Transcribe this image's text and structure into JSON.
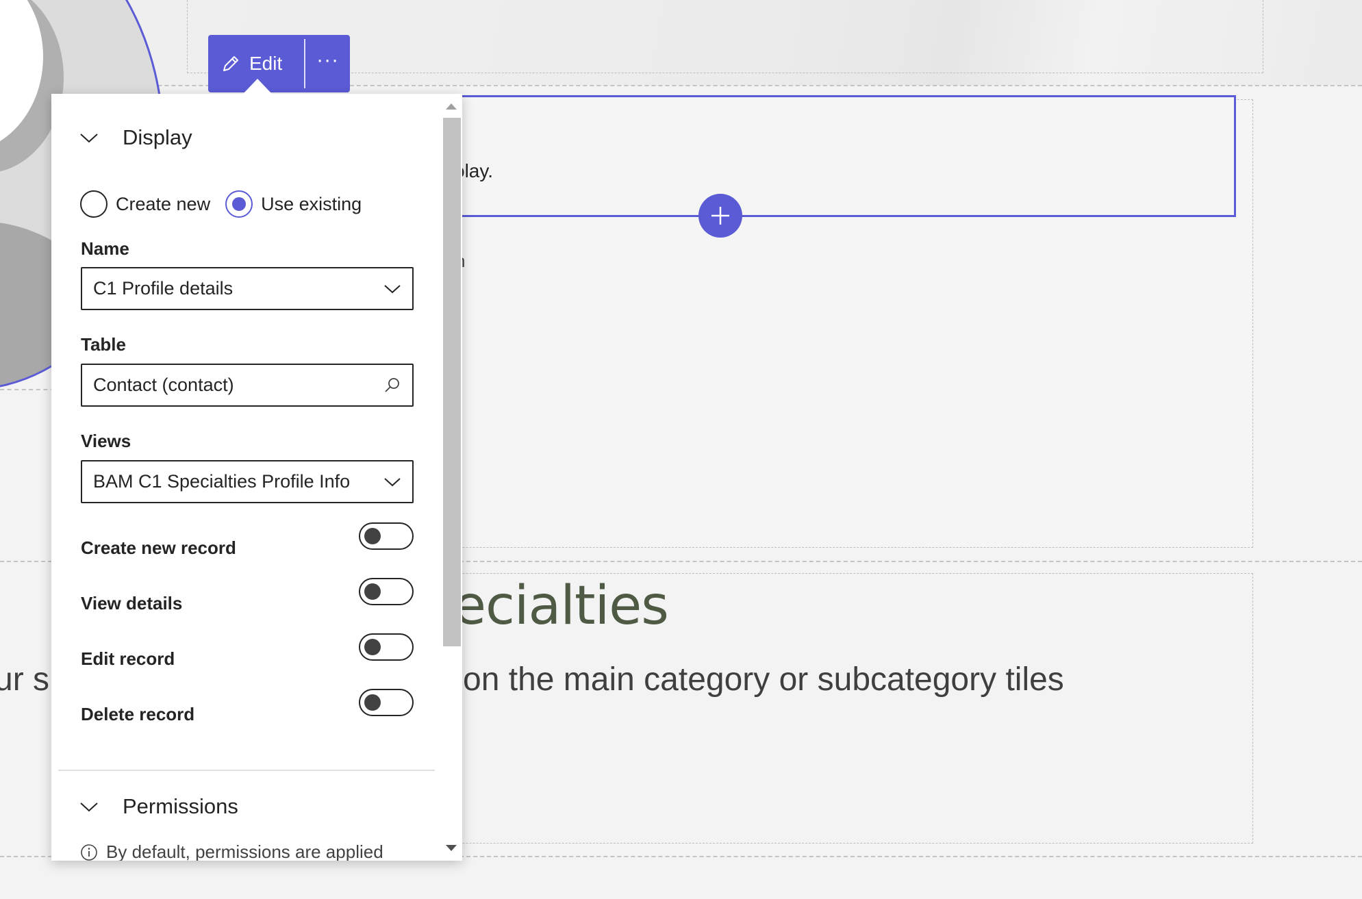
{
  "toolbar": {
    "edit_label": "Edit",
    "more_label": "···"
  },
  "canvas": {
    "list_text": "olay.",
    "stray_char": "n",
    "specialties_title": "ecialties",
    "specialties_subtitle": "on the main category or subcategory tiles",
    "specialties_left": "ur sp"
  },
  "panel": {
    "display_section": {
      "title": "Display",
      "radio_options": [
        {
          "label": "Create new",
          "checked": false
        },
        {
          "label": "Use existing",
          "checked": true
        }
      ],
      "name": {
        "label": "Name",
        "value": "C1 Profile details"
      },
      "table": {
        "label": "Table",
        "value": "Contact (contact)"
      },
      "views": {
        "label": "Views",
        "value": "BAM C1 Specialties Profile Info"
      },
      "toggles": [
        {
          "label": "Create new record",
          "on": false
        },
        {
          "label": "View details",
          "on": false
        },
        {
          "label": "Edit record",
          "on": false
        },
        {
          "label": "Delete record",
          "on": false
        }
      ]
    },
    "permissions_section": {
      "title": "Permissions",
      "info_text": "By default, permissions are applied"
    }
  },
  "colors": {
    "accent": "#5b5bd6",
    "heading_green": "#4f5a45"
  },
  "icons": {
    "edit": "pencil-icon",
    "add": "plus-icon",
    "search": "search-icon",
    "chevron": "chevron-down-icon",
    "info": "info-icon"
  }
}
